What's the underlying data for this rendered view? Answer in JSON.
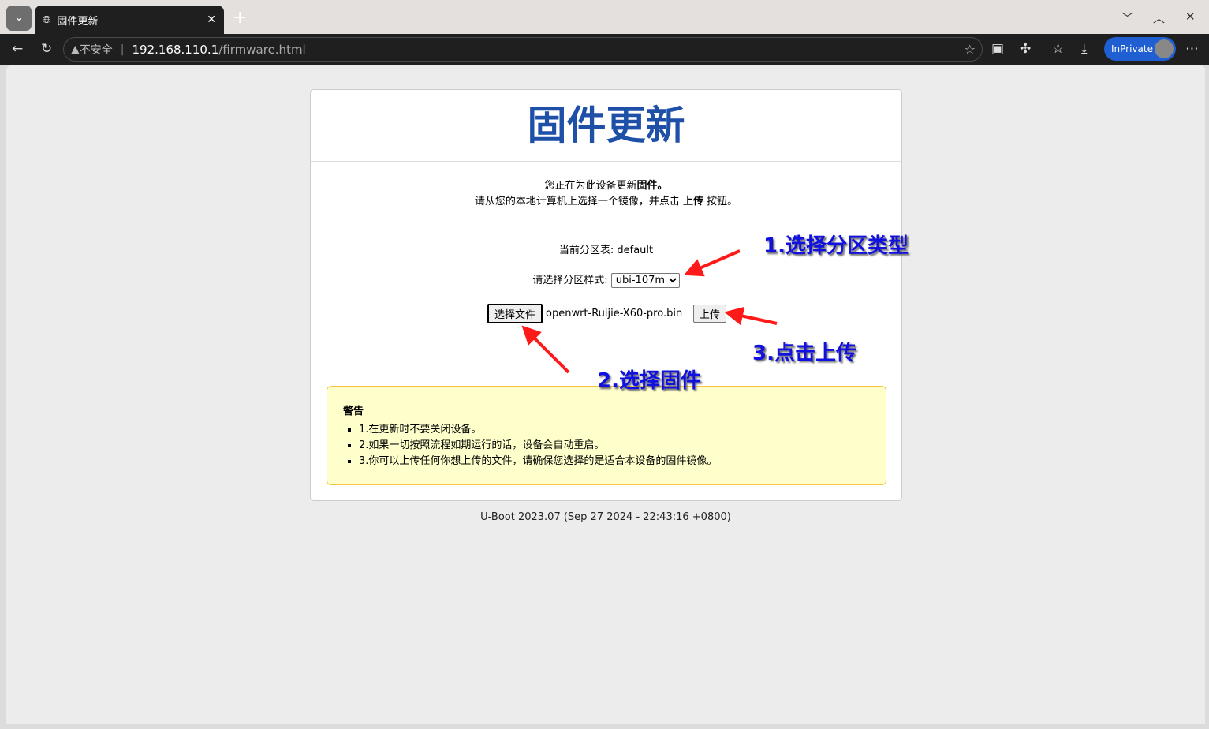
{
  "browser": {
    "tab_title": "固件更新",
    "address": {
      "warning": "不安全",
      "host": "192.168.110.1",
      "path": "/firmware.html"
    },
    "inprivate_label": "InPrivate"
  },
  "page": {
    "title": "固件更新",
    "intro_line1_prefix": "您正在为此设备更新",
    "intro_line1_bold": "固件。",
    "intro_line2_prefix": "请从您的本地计算机上选择一个镜像，并点击 ",
    "intro_line2_bold": "上传",
    "intro_line2_suffix": " 按钮。",
    "partition_table_label": "当前分区表: default",
    "partition_style_label": "请选择分区样式:",
    "partition_style_selected": "ubi-107m",
    "choose_file_label": "选择文件",
    "chosen_file": "openwrt-Ruijie-X60-pro.bin",
    "upload_label": "上传",
    "warning": {
      "title": "警告",
      "items": [
        "1.在更新时不要关闭设备。",
        "2.如果一切按照流程如期运行的话，设备会自动重启。",
        "3.你可以上传任何你想上传的文件，请确保您选择的是适合本设备的固件镜像。"
      ]
    },
    "footer": "U-Boot 2023.07 (Sep 27 2024 - 22:43:16 +0800)"
  },
  "annotations": {
    "step1": "1.选择分区类型",
    "step2": "2.选择固件",
    "step3": "3.点击上传",
    "arrow_color": "#ff1a1a",
    "text_color": "#1010e0"
  }
}
